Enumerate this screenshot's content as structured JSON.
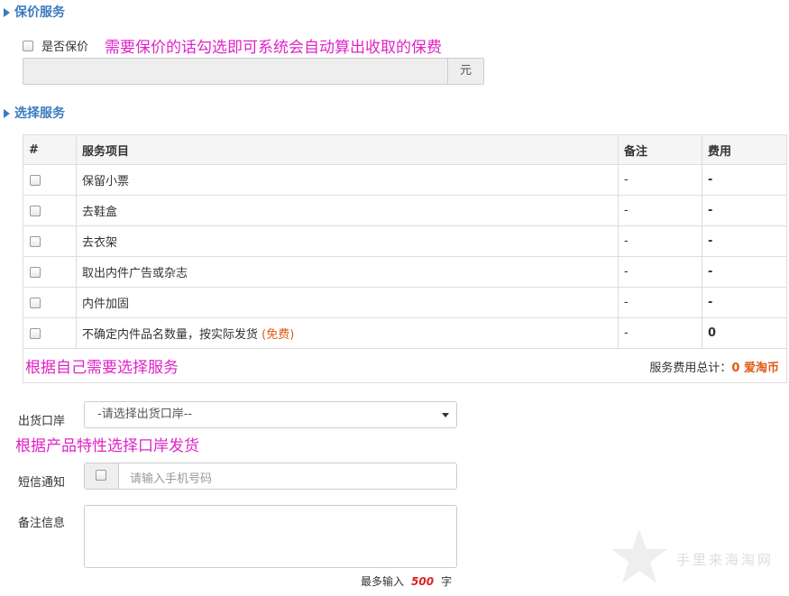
{
  "insurance_section": {
    "title": "保价服务",
    "checkbox_label": "是否保价",
    "annotation": "需要保价的话勾选即可系统会自动算出收取的保费",
    "amount_value": "",
    "unit": "元"
  },
  "services_section": {
    "title": "选择服务",
    "columns": [
      "#",
      "服务项目",
      "备注",
      "费用"
    ],
    "rows": [
      {
        "name": "保留小票",
        "note": "-",
        "fee": "-",
        "free_tag": ""
      },
      {
        "name": "去鞋盒",
        "note": "-",
        "fee": "-",
        "free_tag": ""
      },
      {
        "name": "去衣架",
        "note": "-",
        "fee": "-",
        "free_tag": ""
      },
      {
        "name": "取出内件广告或杂志",
        "note": "-",
        "fee": "-",
        "free_tag": ""
      },
      {
        "name": "内件加固",
        "note": "-",
        "fee": "-",
        "free_tag": ""
      },
      {
        "name": "不确定内件品名数量，按实际发货",
        "note": "-",
        "fee": "0",
        "free_tag": "(免费)"
      }
    ],
    "annotation": "根据自己需要选择服务",
    "total_label": "服务费用总计：",
    "total_value": "0 爱淘币"
  },
  "port": {
    "label": "出货口岸",
    "selected": "-请选择出货口岸--",
    "annotation": "根据产品特性选择口岸发货"
  },
  "sms": {
    "label": "短信通知",
    "placeholder": "请输入手机号码"
  },
  "notes": {
    "label": "备注信息",
    "max_prefix": "最多输入",
    "max_count": "500",
    "max_suffix": "字"
  },
  "watermark": {
    "text": "手里来海淘网"
  },
  "colors": {
    "section_title": "#3a7bbf",
    "annotation": "#e022c8",
    "highlight": "#e05a14"
  }
}
